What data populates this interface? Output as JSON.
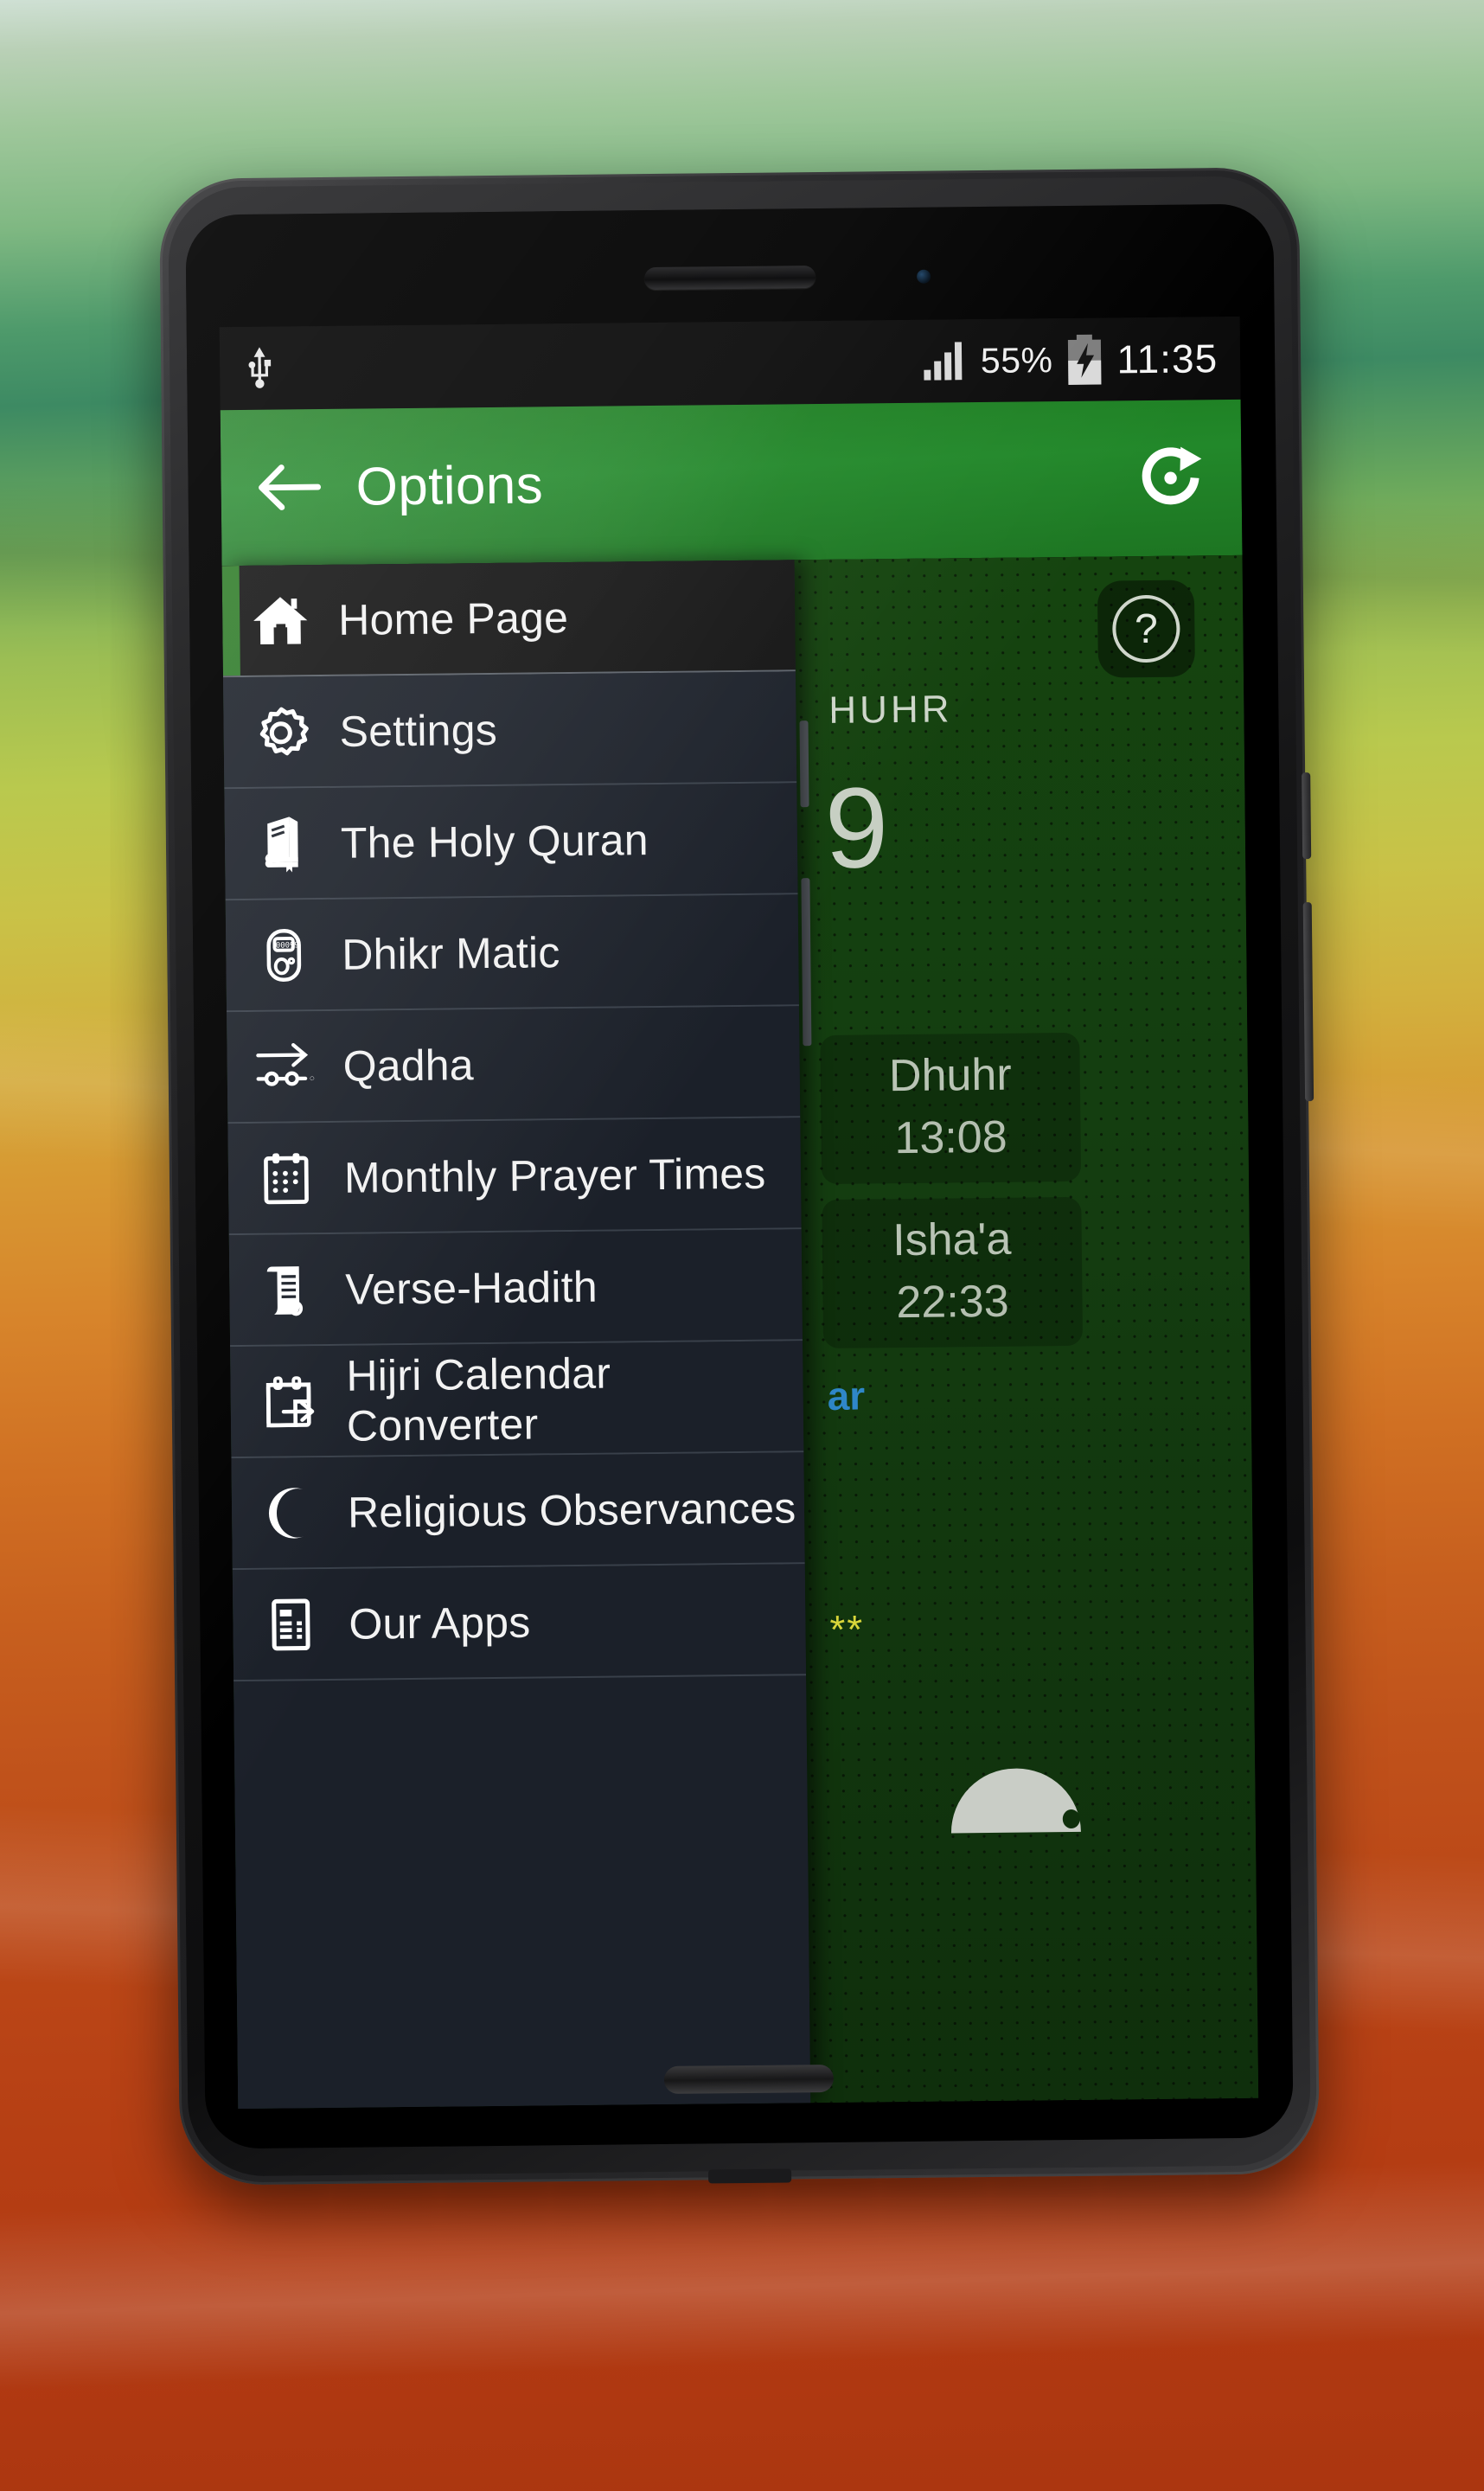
{
  "status_bar": {
    "usb_icon": "usb-icon",
    "signal_icon": "signal-bars-icon",
    "battery_percent": "55%",
    "battery_icon": "battery-charging-icon",
    "clock": "11:35"
  },
  "action_bar": {
    "back_icon": "back-arrow-icon",
    "title": "Options",
    "refresh_icon": "refresh-icon",
    "background_color": "#22882a"
  },
  "drawer": {
    "accent_color": "#2f7c29",
    "items": [
      {
        "label": "Home Page",
        "icon": "home-icon",
        "selected": true
      },
      {
        "label": "Settings",
        "icon": "gear-icon",
        "selected": false
      },
      {
        "label": "The Holy Quran",
        "icon": "book-icon",
        "selected": false
      },
      {
        "label": "Dhikr Matic",
        "icon": "tally-counter-icon",
        "selected": false
      },
      {
        "label": "Qadha",
        "icon": "arrow-over-dots-icon",
        "selected": false
      },
      {
        "label": "Monthly Prayer Times",
        "icon": "calendar-icon",
        "selected": false
      },
      {
        "label": "Verse-Hadith",
        "icon": "scroll-icon",
        "selected": false
      },
      {
        "label": "Hijri Calendar Converter",
        "icon": "calendar-arrow-icon",
        "selected": false
      },
      {
        "label": "Religious Observances",
        "icon": "crescent-moon-icon",
        "selected": false
      },
      {
        "label": "Our Apps",
        "icon": "app-list-icon",
        "selected": false
      }
    ]
  },
  "home_pane": {
    "help_icon": "question-mark-icon",
    "help_label": "?",
    "next_prayer_label": "HUHR",
    "countdown_fragment": "9",
    "cards": [
      {
        "name": "Dhuhr",
        "time": "13:08"
      },
      {
        "name": "Isha'a",
        "time": "22:33"
      }
    ],
    "blue_fragment": "ar",
    "stars_fragment": "**"
  }
}
